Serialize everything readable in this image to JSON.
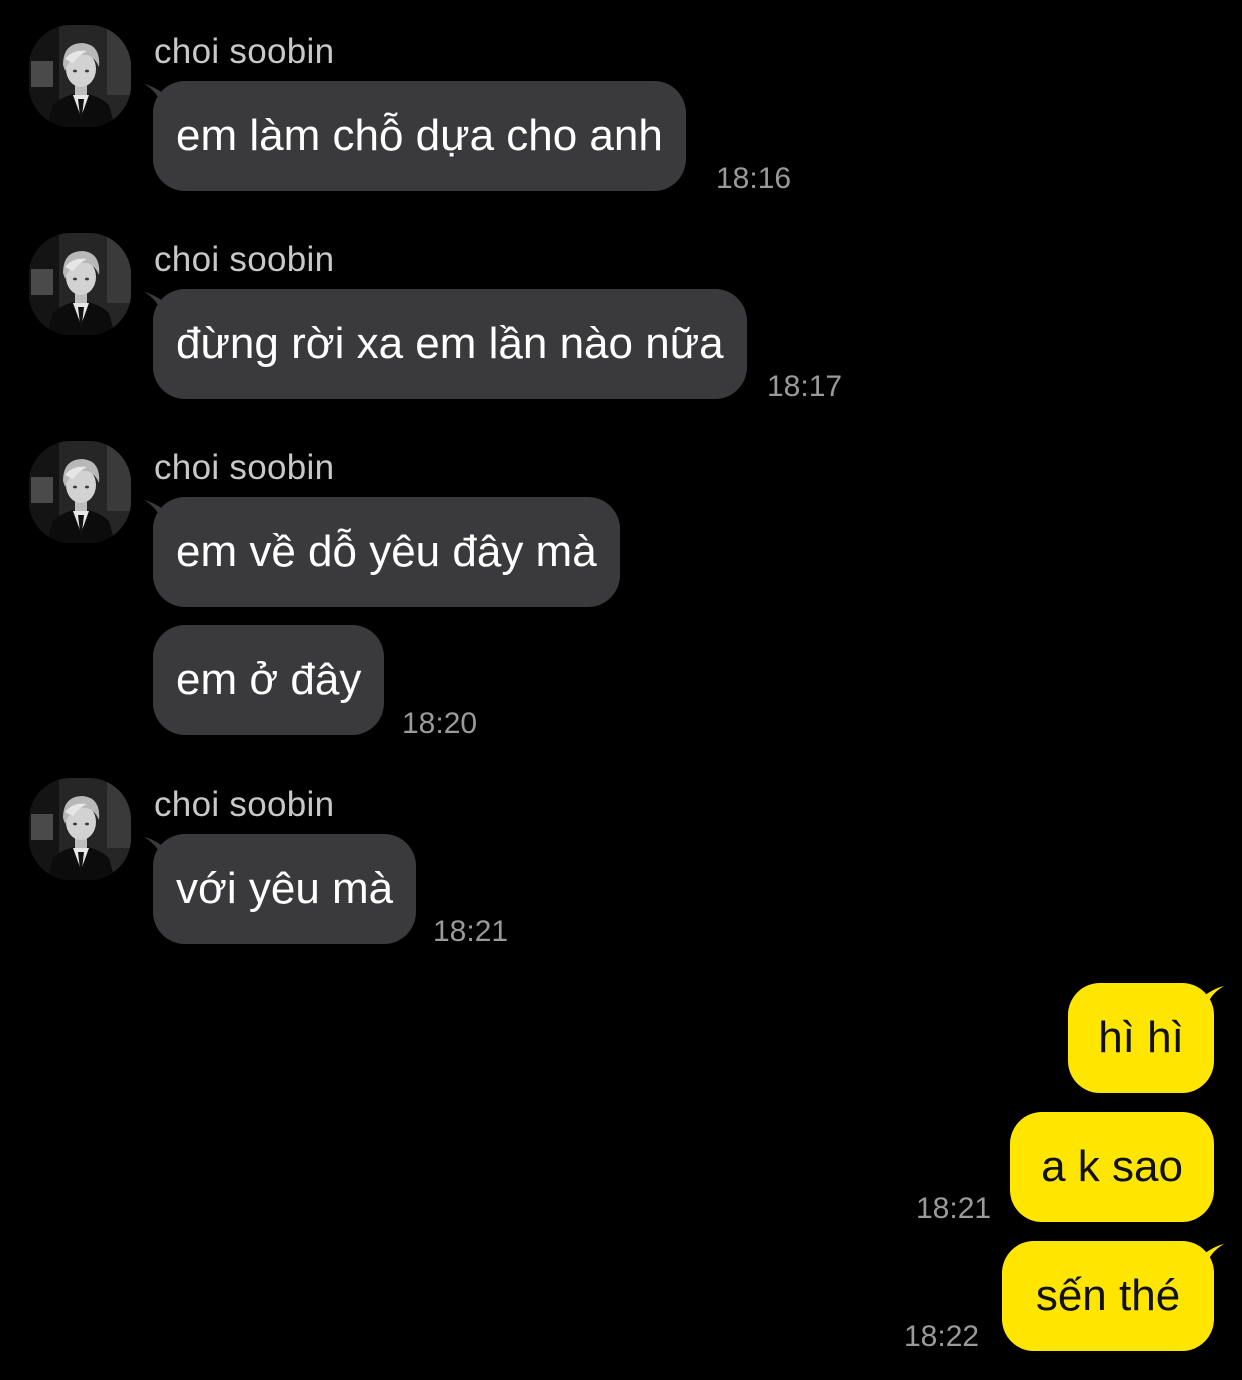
{
  "colors": {
    "background": "#000000",
    "incoming_bubble": "#3a3a3c",
    "outgoing_bubble": "#ffe600",
    "timestamp": "#9a9a9a",
    "sender_name": "#c8c8c8"
  },
  "chat": {
    "groups": [
      {
        "sender": "choi soobin",
        "avatar_icon": "profile-photo-avatar",
        "messages": [
          {
            "text": "em làm chỗ dựa cho anh",
            "time": "18:16"
          }
        ]
      },
      {
        "sender": "choi soobin",
        "avatar_icon": "profile-photo-avatar",
        "messages": [
          {
            "text": "đừng rời xa em lần nào nữa",
            "time": "18:17"
          }
        ]
      },
      {
        "sender": "choi soobin",
        "avatar_icon": "profile-photo-avatar",
        "messages": [
          {
            "text": "em về dỗ yêu đây mà"
          },
          {
            "text": "em ở đây",
            "time": "18:20"
          }
        ]
      },
      {
        "sender": "choi soobin",
        "avatar_icon": "profile-photo-avatar",
        "messages": [
          {
            "text": "với yêu mà",
            "time": "18:21"
          }
        ]
      }
    ],
    "outgoing": [
      {
        "text": "hì hì"
      },
      {
        "text": "a k sao",
        "time": "18:21"
      },
      {
        "text": "sến thé",
        "time": "18:22"
      }
    ]
  }
}
